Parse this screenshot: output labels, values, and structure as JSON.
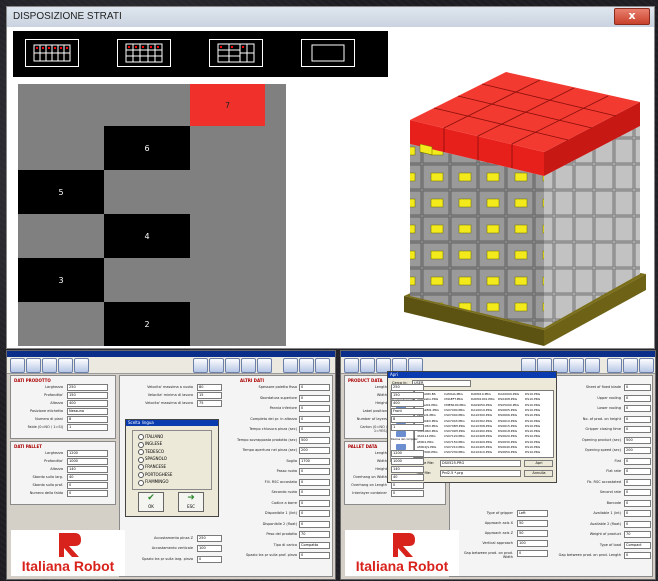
{
  "window": {
    "title": "DISPOSIZIONE STRATI",
    "close_label": "x"
  },
  "layer_grid": {
    "cells": [
      {
        "label": "7",
        "color": "#f0302a"
      },
      {
        "label": "6",
        "color": "#000000"
      },
      {
        "label": "5",
        "color": "#000000"
      },
      {
        "label": "4",
        "color": "#000000"
      },
      {
        "label": "3",
        "color": "#000000"
      },
      {
        "label": "2",
        "color": "#000000"
      }
    ],
    "background": "#808080"
  },
  "left_panel": {
    "sections": {
      "product": "DATI PRODOTTO",
      "pallet": "DATI PALLET",
      "other": "ALTRI DATI"
    },
    "product_fields": [
      {
        "label": "Larghezza",
        "value": "250"
      },
      {
        "label": "Profondita'",
        "value": "150"
      },
      {
        "label": "Altezza",
        "value": "400"
      },
      {
        "label": "Posizione etichetta",
        "value": "Nessuna"
      },
      {
        "label": "Numero di piani",
        "value": "8"
      },
      {
        "label": "Falde (0=NO / 1=SI)",
        "value": "1"
      }
    ],
    "pallet_fields": [
      {
        "label": "Larghezza",
        "value": "1200"
      },
      {
        "label": "Profondita'",
        "value": "1000"
      },
      {
        "label": "Altezza",
        "value": "140"
      },
      {
        "label": "Sbordo sulla larg.",
        "value": "40"
      },
      {
        "label": "Sbordo sulla prof.",
        "value": "0"
      },
      {
        "label": "Numero della falda",
        "value": "0"
      }
    ],
    "other_fields_left": [
      {
        "label": "Velocita' massima a vuoto",
        "value": "80"
      },
      {
        "label": "Velocita' minima di lavoro",
        "value": "15"
      },
      {
        "label": "Velocita' massima di lavoro",
        "value": "75"
      },
      {
        "label": "Accostamento pinza Z",
        "value": "250"
      },
      {
        "label": "Accostamento verticale",
        "value": "100"
      },
      {
        "label": "Spazio tra pr sulla larg. pinza",
        "value": "0"
      }
    ],
    "other_fields_right": [
      {
        "label": "Spessore paletta fissa",
        "value": "0"
      },
      {
        "label": "Sbordatura superiore",
        "value": "0"
      },
      {
        "label": "Pannia inferiore",
        "value": "0"
      },
      {
        "label": "Completo dei pr. in altezza",
        "value": "0"
      },
      {
        "label": "Tempo chiusura pinza (sec)",
        "value": "0"
      },
      {
        "label": "Tempo sovrapposta prodotto (sec)",
        "value": "500"
      },
      {
        "label": "Tempo apertura nei pinza (sec)",
        "value": "200"
      },
      {
        "label": "Soglia",
        "value": "1700"
      },
      {
        "label": "Passo ruota",
        "value": "0"
      },
      {
        "label": "Flli. RSC accostato",
        "value": "0"
      },
      {
        "label": "Secondo ruota",
        "value": "0"
      },
      {
        "label": "Codice a barre",
        "value": "0"
      },
      {
        "label": "Disponibile 1 (lint)",
        "value": "0"
      },
      {
        "label": "Disponibile 2 (float)",
        "value": "0"
      },
      {
        "label": "Peso del prodotto",
        "value": "70"
      },
      {
        "label": "Tipo di carico",
        "value": "Compatto"
      },
      {
        "label": "Spazio tra pr sulla prof. pinza",
        "value": "0"
      }
    ],
    "dialog": {
      "title": "Scelta lingua",
      "languages": [
        "ITALIANO",
        "INGLESE",
        "TEDESCO",
        "SPAGNOLO",
        "FRANCESE",
        "PORTOGHESE",
        "FIAMMINGO"
      ],
      "ok_label": "OK",
      "exit_label": "ESC"
    },
    "logo": "Italiana Robot"
  },
  "right_panel": {
    "sections": {
      "product": "PRODUCT DATA",
      "pallet": "PALLET DATA"
    },
    "product_fields": [
      {
        "label": "Length",
        "value": "250"
      },
      {
        "label": "Width",
        "value": "150"
      },
      {
        "label": "Height",
        "value": "400"
      },
      {
        "label": "Label position",
        "value": "Front"
      },
      {
        "label": "Number of layers",
        "value": "8"
      },
      {
        "label": "Carton (0=NO / 1=YES)",
        "value": "1"
      }
    ],
    "pallet_fields": [
      {
        "label": "Length",
        "value": "1200"
      },
      {
        "label": "Width",
        "value": "1000"
      },
      {
        "label": "Height",
        "value": "140"
      },
      {
        "label": "Overhang on Width",
        "value": "40"
      },
      {
        "label": "Overhang on Length",
        "value": "0"
      },
      {
        "label": "Interlayer container",
        "value": "0"
      }
    ],
    "bottom_fields": [
      {
        "label": "Type of gripper",
        "value": "Left"
      },
      {
        "label": "Approach axis X",
        "value": "50"
      },
      {
        "label": "Approach axis Z",
        "value": "50"
      },
      {
        "label": "Vertical approach",
        "value": "100"
      },
      {
        "label": "Gap between prod. on prod. Width",
        "value": "0"
      }
    ],
    "right_labels": [
      "Sheet of fixed blade",
      "Upper rooling",
      "Lower rooling",
      "No. of prod. on height",
      "Gripper closing time",
      "Opening product (sec)",
      "Opening speed (sec)",
      "Flat",
      "Flat rate",
      "Fb. RSC accostated",
      "Second rate",
      "Barcode",
      "Available 1 (int)",
      "Available 2 (float)",
      "Weight of product",
      "Type of load",
      "Gap between prod. on prod. Length"
    ],
    "right_values": [
      "0",
      "0",
      "0",
      "0",
      "0",
      "500",
      "200",
      "0",
      "0",
      "0",
      "0",
      "0",
      "0",
      "0",
      "70",
      "Compact",
      "0"
    ],
    "dialog": {
      "title": "Apri",
      "look_in_label": "Cerca in:",
      "look_in_value": "USER",
      "places": [
        "Documenti recenti",
        "Desktop",
        "Documenti",
        "Risorse del computer",
        "Risorse di rete"
      ],
      "files": [
        "00-HAND.BS",
        "1Sgrestio.PRG",
        "2Rmal01.PRG",
        "2zDa1Bt1.PRG",
        "2zMail1.PRG",
        "2S0004D.PRG",
        "3S0105D.PRG",
        "3S0106D.PRG",
        "4S0114.PRG",
        "AMI01.PRG",
        "AMI01JS.PRG",
        "BS02000.PRG",
        "CAMAIA.PRG",
        "CMAEFT.PRG",
        "CMEN100.PRG",
        "CS07000.PRG",
        "CS07040.PRG",
        "CS07043.PRG",
        "CS0708H.PRG",
        "CS0709H.PRG",
        "CS07120.PRG",
        "CS07150.PRG",
        "CS07210.PRG",
        "CS07230.PRG",
        "DAM010.PRG",
        "DAM01001.PRG",
        "DA09050.PRG",
        "DA10019.PRG",
        "DA10300.PRG",
        "DA10302.PRG",
        "DA10308.PRG",
        "DA10400.PRG",
        "DA10408.PRG",
        "DA10409.PRG",
        "DA10405.PRG",
        "DA10410.PRG",
        "DA20000.PRG",
        "DS0408.PRG",
        "DS05000.PRG",
        "DS0605.PRG",
        "DS0606.PRG",
        "DS0610.PRG",
        "DS0615.PRG",
        "DS0618.PRG",
        "DS0620.PRG",
        "DS0630.PRG",
        "DS0640.PRG",
        "DS0650.PRG",
        "DS10.PRG",
        "DS10.PRG",
        "DS10.PRG",
        "DS10.PRG",
        "DS10.PRG",
        "DS10.PRG",
        "DS10.PRG",
        "DS10.PRG",
        "DS10.PRG",
        "DS10.PRG",
        "DS10.PRG",
        "DS10.PRG"
      ],
      "filename_label": "Nome file:",
      "filename_value": "DS0525.PRG",
      "filetype_label": "Tipo file:",
      "filetype_value": "Prd2.5 *.prg",
      "open_label": "Apri",
      "cancel_label": "Annulla"
    },
    "logo": "Italiana Robot"
  }
}
